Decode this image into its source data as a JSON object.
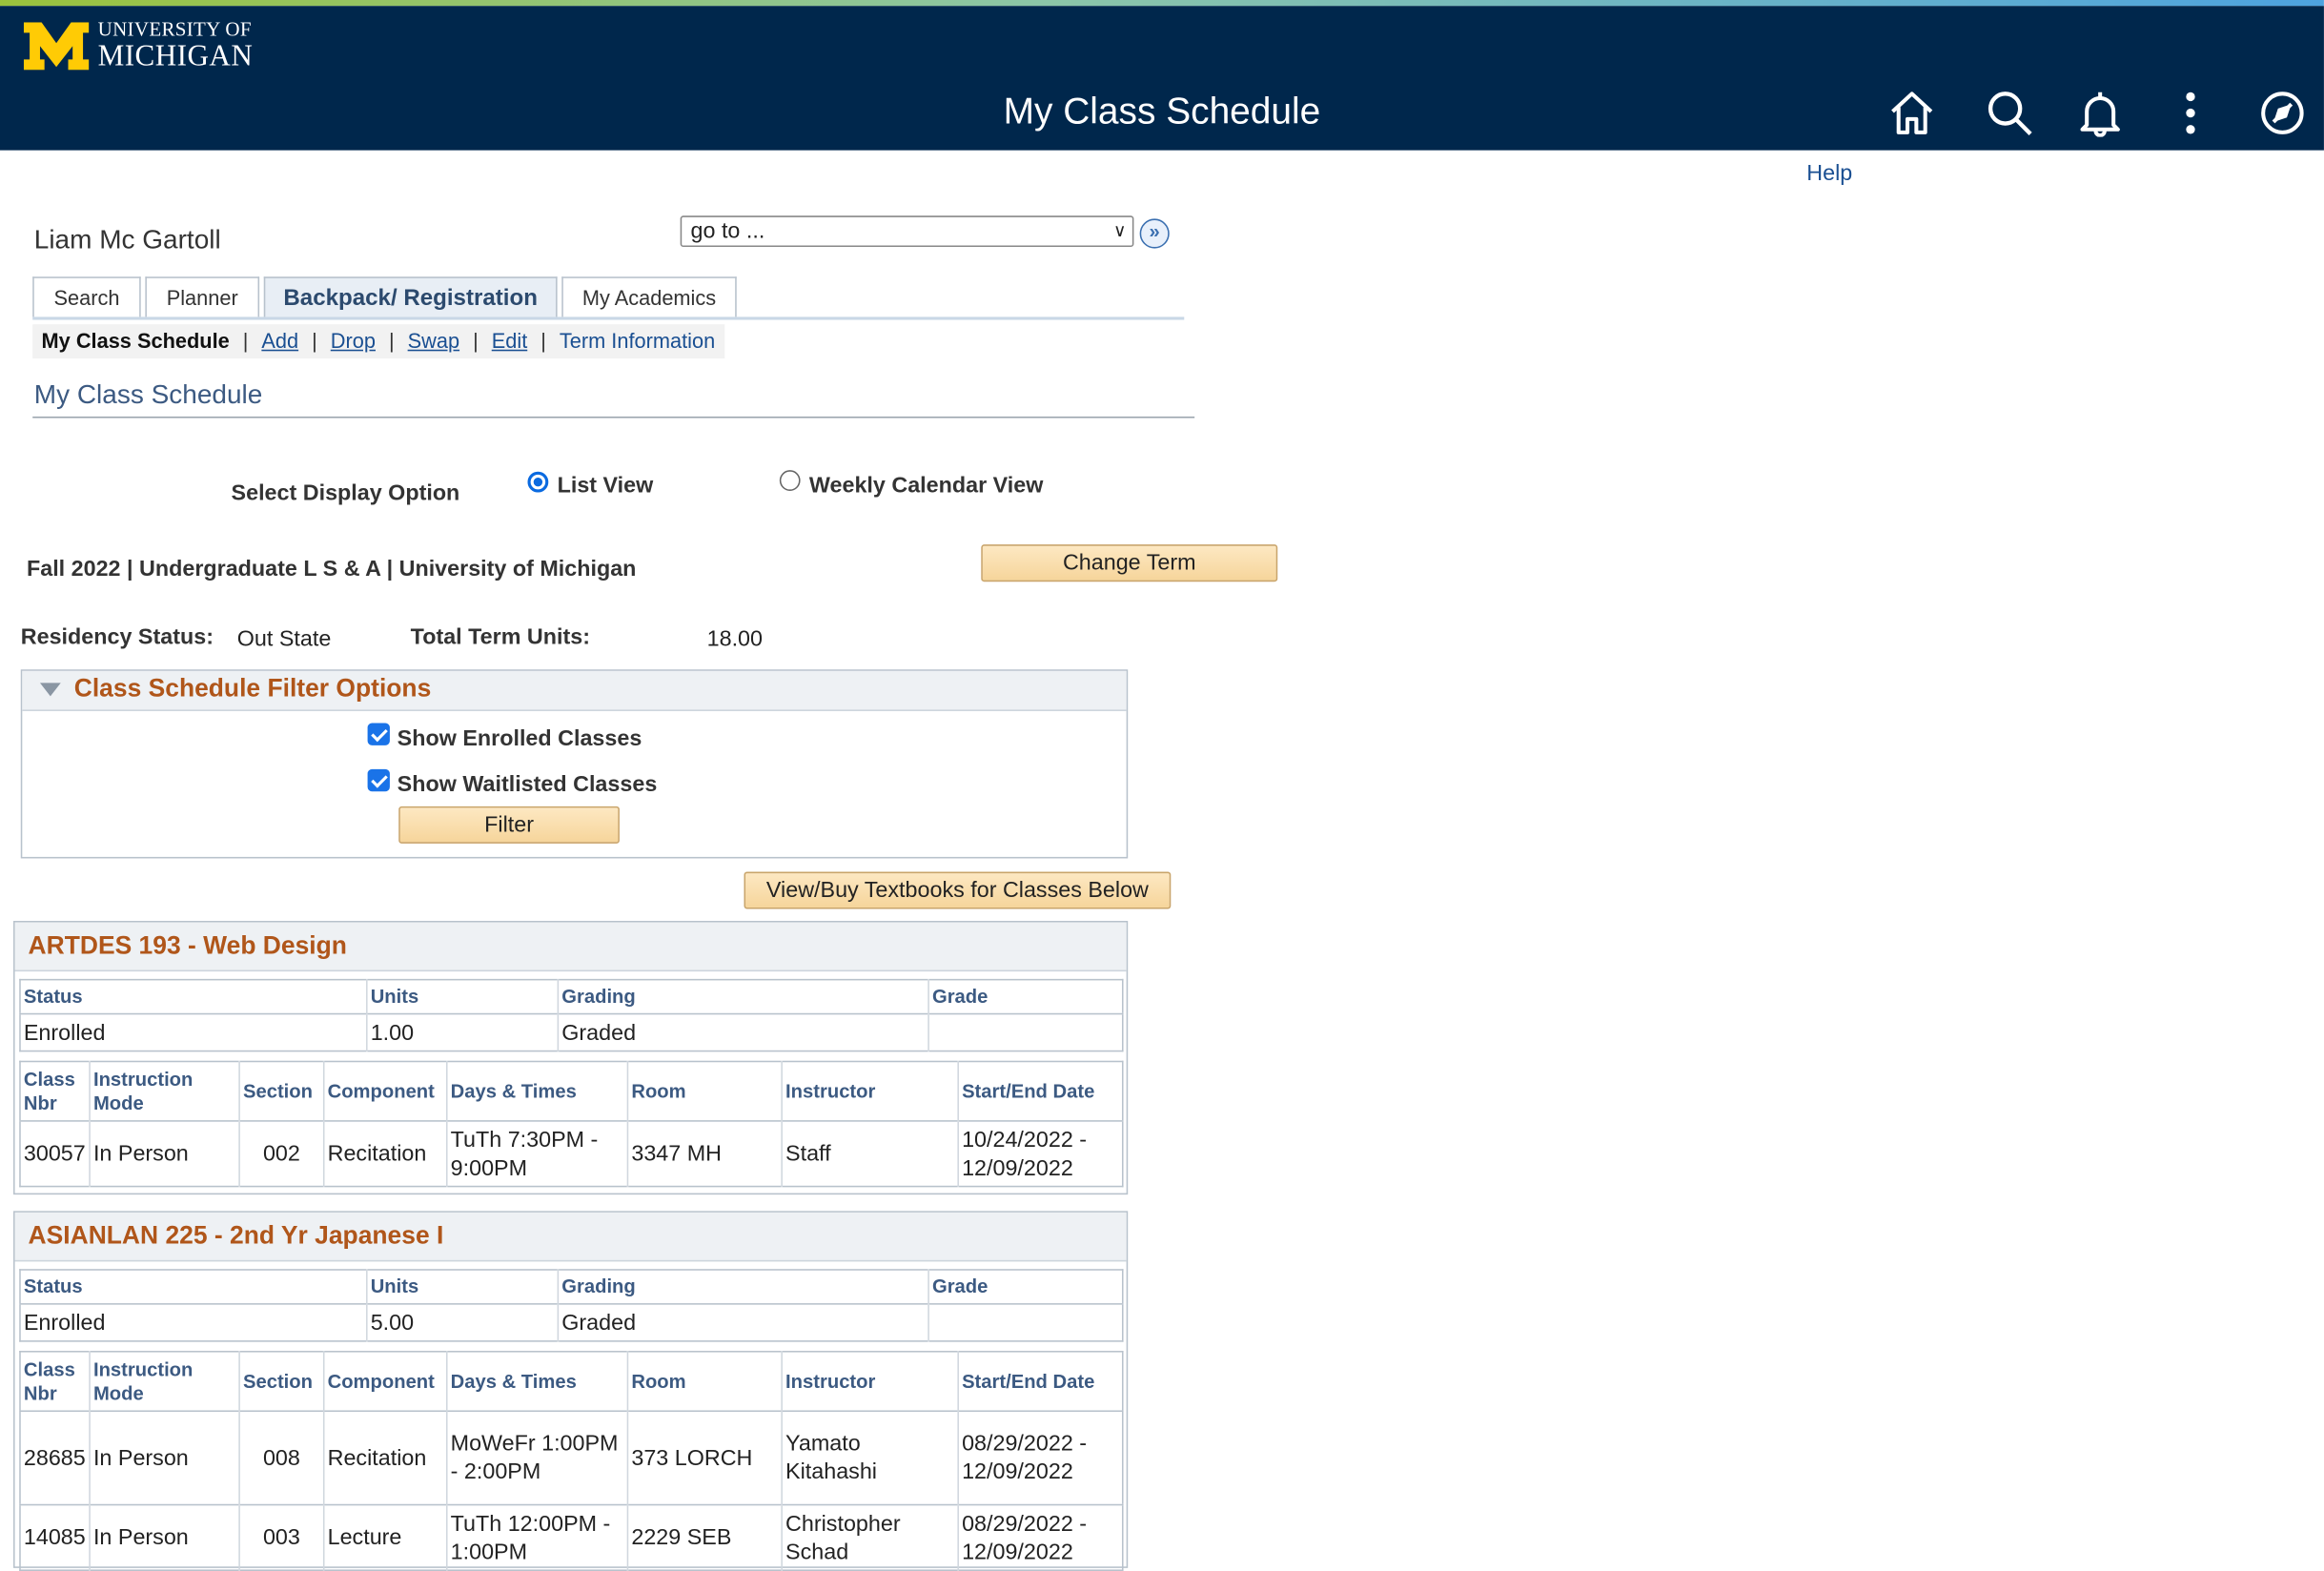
{
  "brand": {
    "logo_letter": "M",
    "logo_line1": "UNIVERSITY OF",
    "logo_line2": "MICHIGAN",
    "navy": "#00274c",
    "maize": "#ffcb05"
  },
  "header": {
    "title": "My Class Schedule",
    "icons": [
      "home-icon",
      "search-icon",
      "bell-icon",
      "more-vertical-icon",
      "compass-icon"
    ]
  },
  "help_label": "Help",
  "user_name": "Liam Mc Gartoll",
  "goto": {
    "value": "go to ..."
  },
  "tabs": [
    {
      "label": "Search"
    },
    {
      "label": "Planner"
    },
    {
      "label": "Backpack/ Registration"
    },
    {
      "label": "My Academics"
    }
  ],
  "subnav": {
    "current": "My Class Schedule",
    "add": "Add",
    "drop": "Drop",
    "swap": "Swap",
    "edit": "Edit",
    "term_info": "Term Information"
  },
  "page_title": "My Class Schedule",
  "display": {
    "label": "Select Display Option",
    "list_view": "List View",
    "calendar_view": "Weekly Calendar View",
    "selected": "List View"
  },
  "term": {
    "text": "Fall 2022 | Undergraduate L S & A | University of Michigan",
    "change_label": "Change Term"
  },
  "residency": {
    "label": "Residency Status:",
    "value": "Out State",
    "units_label": "Total Term Units:",
    "units_value": "18.00"
  },
  "filter": {
    "title": "Class Schedule Filter Options",
    "enrolled": "Show Enrolled Classes",
    "waitlisted": "Show Waitlisted Classes",
    "button": "Filter",
    "enrolled_checked": true,
    "waitlisted_checked": true
  },
  "textbooks_label": "View/Buy Textbooks for Classes Below",
  "summary_headers": {
    "status": "Status",
    "units": "Units",
    "grading": "Grading",
    "grade": "Grade"
  },
  "detail_headers": {
    "class_nbr": "Class Nbr",
    "mode": "Instruction Mode",
    "section": "Section",
    "component": "Component",
    "days": "Days & Times",
    "room": "Room",
    "instructor": "Instructor",
    "dates": "Start/End Date"
  },
  "courses": [
    {
      "title": "ARTDES 193 - Web Design",
      "status": "Enrolled",
      "units": "1.00",
      "grading": "Graded",
      "grade": "",
      "rows": [
        {
          "nbr": "30057",
          "mode": "In Person",
          "section": "002",
          "component": "Recitation",
          "days": "TuTh 7:30PM - 9:00PM",
          "room": "3347 MH",
          "instructor": "Staff",
          "dates": "10/24/2022 - 12/09/2022"
        }
      ]
    },
    {
      "title": "ASIANLAN 225 - 2nd Yr Japanese I",
      "status": "Enrolled",
      "units": "5.00",
      "grading": "Graded",
      "grade": "",
      "rows": [
        {
          "nbr": "28685",
          "mode": "In Person",
          "section": "008",
          "component": "Recitation",
          "days": "MoWeFr 1:00PM - 2:00PM",
          "room": "373 LORCH",
          "instructor": "Yamato Kitahashi",
          "dates": "08/29/2022 - 12/09/2022"
        },
        {
          "nbr": "14085",
          "mode": "In Person",
          "section": "003",
          "component": "Lecture",
          "days": "TuTh 12:00PM - 1:00PM",
          "room": "2229 SEB",
          "instructor": "Christopher Schad",
          "dates": "08/29/2022 - 12/09/2022"
        }
      ]
    }
  ]
}
